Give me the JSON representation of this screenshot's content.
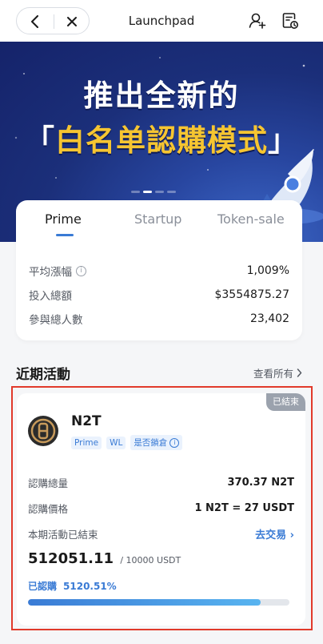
{
  "header": {
    "title": "Launchpad",
    "icons": {
      "back": "chevron-left-icon",
      "close": "close-icon",
      "user": "user-add-icon",
      "history": "history-icon"
    }
  },
  "banner": {
    "line1": "推出全新的",
    "line2_open": "「",
    "line2_main": "白名单認購模式",
    "line2_close": "」",
    "slide_count": 4,
    "active_slide": 1
  },
  "tabs": [
    {
      "label": "Prime",
      "active": true
    },
    {
      "label": "Startup",
      "active": false
    },
    {
      "label": "Token-sale",
      "active": false
    }
  ],
  "stats": [
    {
      "label": "平均漲幅",
      "value": "1,009%",
      "has_info": true
    },
    {
      "label": "投入總額",
      "value": "$3554875.27",
      "has_info": false
    },
    {
      "label": "參與總人數",
      "value": "23,402",
      "has_info": false
    }
  ],
  "section": {
    "title": "近期活動",
    "view_all": "查看所有"
  },
  "activity": {
    "status": "已結束",
    "token": "N2T",
    "tags": [
      "Prime",
      "WL",
      "是否鎖倉"
    ],
    "rows": [
      {
        "label": "認購總量",
        "value": "370.37 N2T"
      },
      {
        "label": "認購價格",
        "value": "1 N2T = 27 USDT"
      },
      {
        "label": "本期活動已結束",
        "link": "去交易"
      }
    ],
    "amount": "512051.11",
    "amount_total": "/ 10000 USDT",
    "subscribed_label": "已認購",
    "subscribed_pct": "5120.51%",
    "progress": 0.89
  },
  "colors": {
    "accent": "#3a7bd5",
    "gold": "#f6c531",
    "banner": "#1b2f7a",
    "highlight": "#e13a2b"
  }
}
